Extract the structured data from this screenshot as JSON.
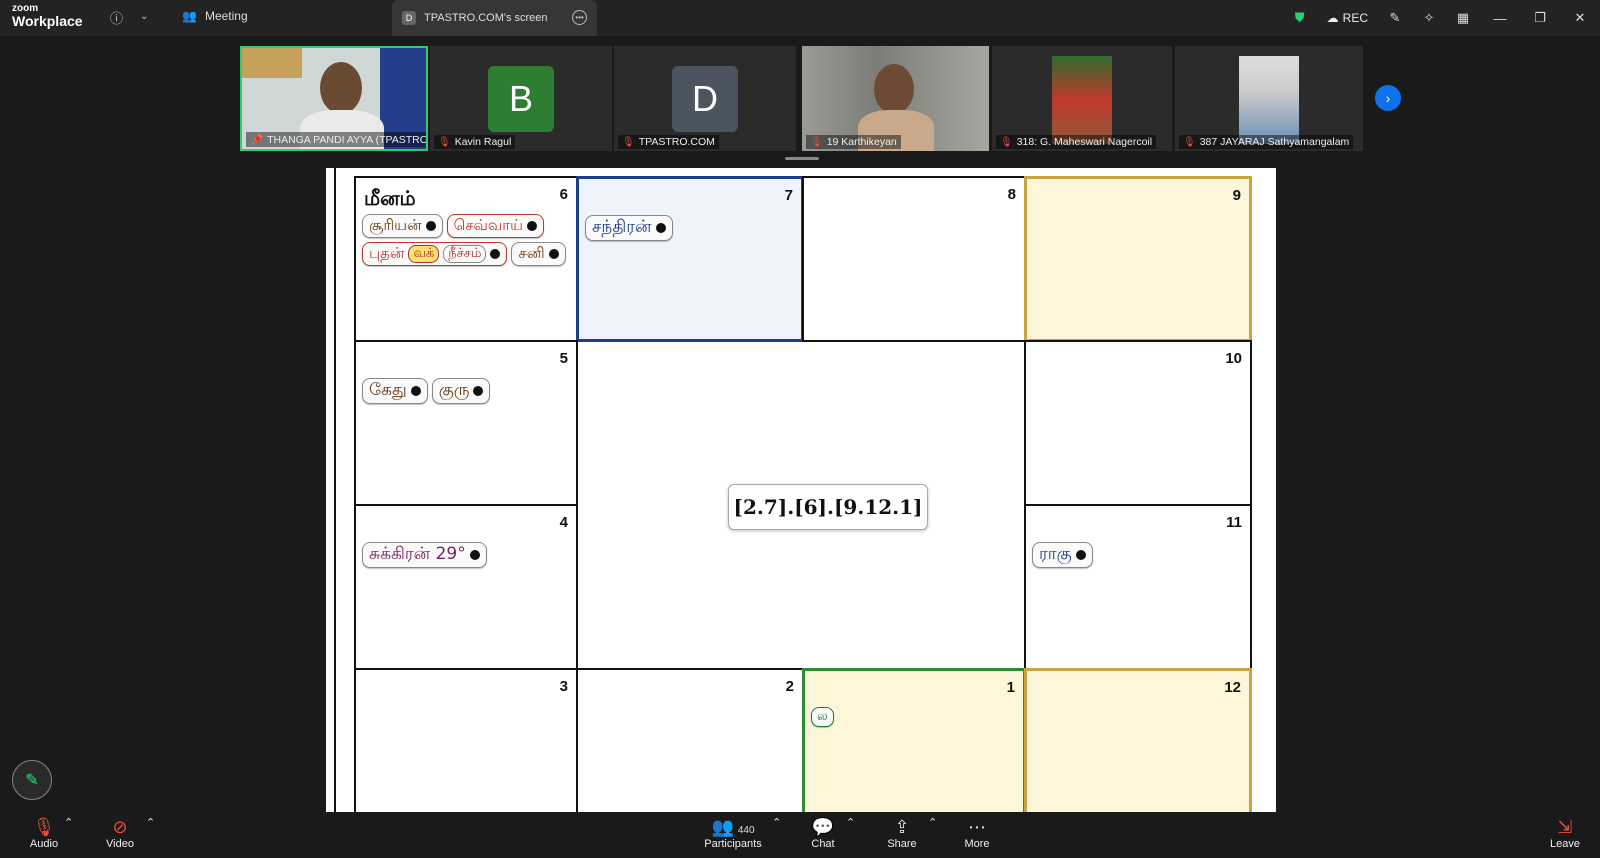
{
  "app": {
    "logo_line1": "zoom",
    "logo_line2": "Workplace"
  },
  "topbar": {
    "meeting_label": "Meeting",
    "screen_tab_badge": "D",
    "screen_tab_label": "TPASTRO.COM's screen",
    "rec_label": "REC"
  },
  "participants": [
    {
      "name": "THANGA PANDI AYYA (TPASTRO...",
      "type": "video"
    },
    {
      "name": "Kavin Ragul",
      "type": "avatar",
      "letter": "B",
      "color": "#2e7d32"
    },
    {
      "name": "TPASTRO.COM",
      "type": "avatar",
      "letter": "D",
      "color": "#4a5560"
    },
    {
      "name": "19 Karthikeyan",
      "type": "video"
    },
    {
      "name": "318: G. Maheswari Nagercoil",
      "type": "video"
    },
    {
      "name": "387 JAYARAJ  Sathyamangalam",
      "type": "video"
    }
  ],
  "chart": {
    "rasi_name": "மீனம்",
    "center_text": "[2.7].[6].[9.12.1]",
    "houses": {
      "h6": {
        "num": "6",
        "planets": [
          "சூரியன்",
          "செவ்வாய்",
          "புதன்",
          "வக்",
          "நீச்சம்",
          "சனி"
        ]
      },
      "h7": {
        "num": "7",
        "planets": [
          "சந்திரன்"
        ]
      },
      "h8": {
        "num": "8"
      },
      "h9": {
        "num": "9"
      },
      "h5": {
        "num": "5",
        "planets": [
          "கேது",
          "குரு"
        ]
      },
      "h10": {
        "num": "10"
      },
      "h4": {
        "num": "4",
        "planets": [
          "சுக்கிரன் 29°"
        ]
      },
      "h11": {
        "num": "11",
        "planets": [
          "ராகு"
        ]
      },
      "h3": {
        "num": "3"
      },
      "h2": {
        "num": "2"
      },
      "h1": {
        "num": "1",
        "planets": [
          "ல"
        ]
      },
      "h12": {
        "num": "12"
      }
    }
  },
  "bottombar": {
    "audio": "Audio",
    "video": "Video",
    "participants": "Participants",
    "participants_count": "440",
    "chat": "Chat",
    "share": "Share",
    "more": "More",
    "leave": "Leave"
  },
  "colors": {
    "active_speaker": "#2ecc71",
    "highlight_blue_cell": "#eef3fc",
    "highlight_yellow_cell": "#fdf6d9",
    "blue_border": "#1c3f8a",
    "gold_border": "#c9a43d",
    "green_border": "#2e8b2e"
  }
}
